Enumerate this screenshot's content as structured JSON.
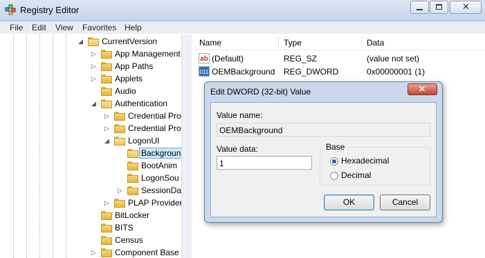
{
  "window": {
    "title": "Registry Editor"
  },
  "menu": [
    "File",
    "Edit",
    "View",
    "Favorites",
    "Help"
  ],
  "tree": [
    {
      "label": "CurrentVersion",
      "level": 0,
      "expander": "expanded",
      "open": true
    },
    {
      "label": "App Management",
      "level": 1,
      "expander": "collapsed"
    },
    {
      "label": "App Paths",
      "level": 1,
      "expander": "collapsed"
    },
    {
      "label": "Applets",
      "level": 1,
      "expander": "collapsed"
    },
    {
      "label": "Audio",
      "level": 1,
      "expander": "none"
    },
    {
      "label": "Authentication",
      "level": 1,
      "expander": "expanded",
      "open": true
    },
    {
      "label": "Credential Pro",
      "level": 2,
      "expander": "collapsed"
    },
    {
      "label": "Credential Pro",
      "level": 2,
      "expander": "collapsed"
    },
    {
      "label": "LogonUI",
      "level": 2,
      "expander": "expanded",
      "open": true
    },
    {
      "label": "Backgroun",
      "level": 3,
      "expander": "none",
      "selected": true,
      "open": true
    },
    {
      "label": "BootAnim",
      "level": 3,
      "expander": "none"
    },
    {
      "label": "LogonSou",
      "level": 3,
      "expander": "none"
    },
    {
      "label": "SessionDat",
      "level": 3,
      "expander": "collapsed"
    },
    {
      "label": "PLAP Provider",
      "level": 2,
      "expander": "collapsed"
    },
    {
      "label": "BitLocker",
      "level": 1,
      "expander": "none"
    },
    {
      "label": "BITS",
      "level": 1,
      "expander": "none"
    },
    {
      "label": "Census",
      "level": 1,
      "expander": "none"
    },
    {
      "label": "Component Base",
      "level": 1,
      "expander": "collapsed"
    }
  ],
  "list": {
    "columns": [
      "Name",
      "Type",
      "Data"
    ],
    "rows": [
      {
        "icon": "string-value-icon",
        "name": "(Default)",
        "type": "REG_SZ",
        "data": "(value not set)"
      },
      {
        "icon": "dword-value-icon",
        "name": "OEMBackground",
        "type": "REG_DWORD",
        "data": "0x00000001 (1)"
      }
    ]
  },
  "dialog": {
    "title": "Edit DWORD (32-bit) Value",
    "value_name_label": "Value name:",
    "value_name": "OEMBackground",
    "value_data_label": "Value data:",
    "value_data": "1",
    "base_label": "Base",
    "base_options": [
      "Hexadecimal",
      "Decimal"
    ],
    "base_selected": "Hexadecimal",
    "ok_label": "OK",
    "cancel_label": "Cancel"
  }
}
